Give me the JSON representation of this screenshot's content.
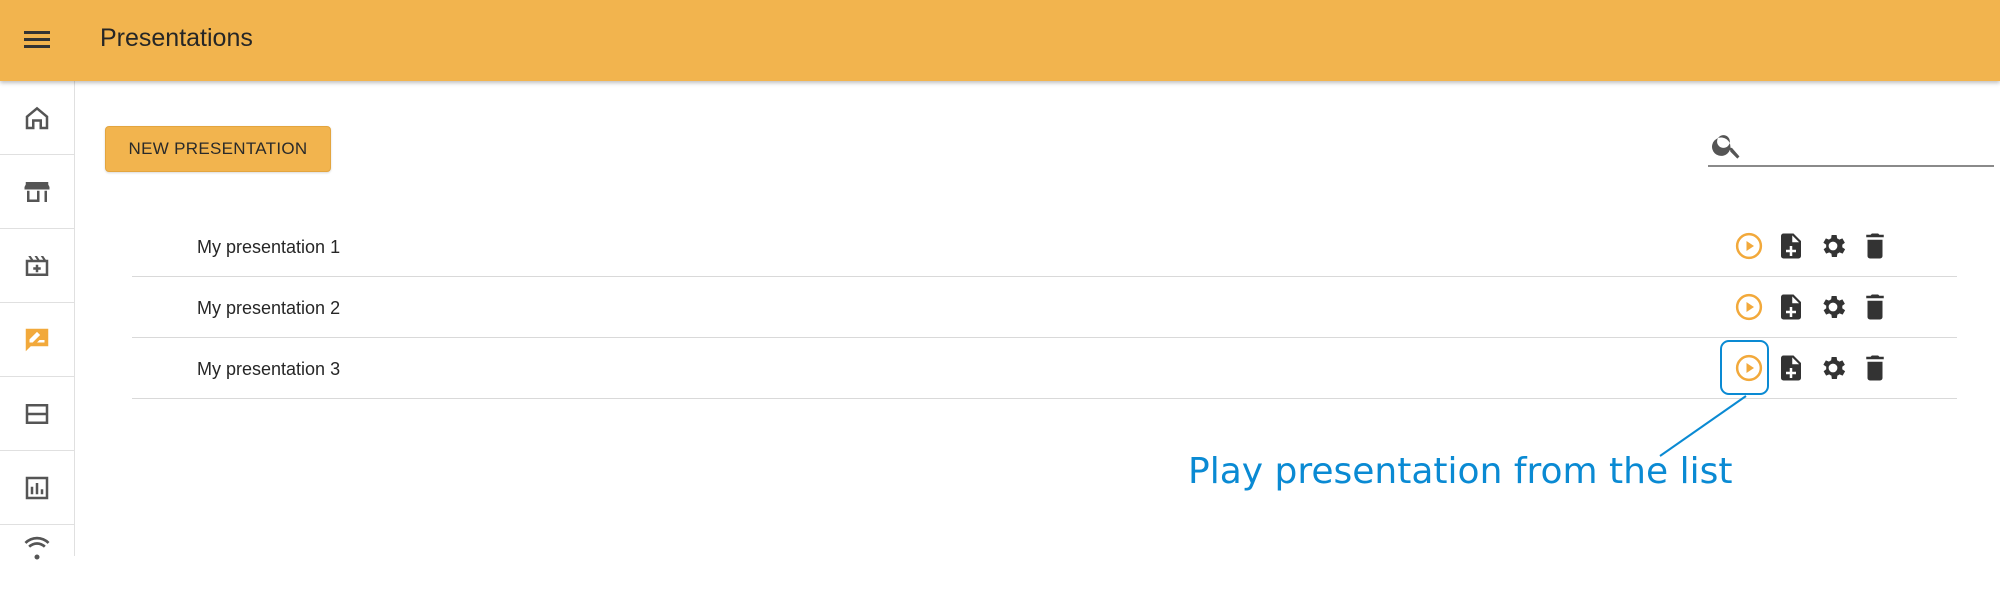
{
  "app": {
    "title": "Presentations"
  },
  "toolbar": {
    "new_label": "NEW PRESENTATION"
  },
  "search": {
    "placeholder": "",
    "value": ""
  },
  "sidebar": {
    "items": [
      {
        "icon": "home-icon"
      },
      {
        "icon": "store-icon"
      },
      {
        "icon": "movie-add-icon"
      },
      {
        "icon": "presentation-edit-icon",
        "active": true
      },
      {
        "icon": "table-layout-icon"
      },
      {
        "icon": "chart-icon"
      },
      {
        "icon": "wifi-icon"
      }
    ]
  },
  "presentations": [
    {
      "name": "My presentation 1"
    },
    {
      "name": "My presentation 2"
    },
    {
      "name": "My presentation 3"
    }
  ],
  "row_actions": [
    "play-icon",
    "add-file-icon",
    "settings-icon",
    "delete-icon"
  ],
  "annotation": {
    "text": "Play presentation from the list"
  },
  "colors": {
    "accent": "#f2b44e",
    "icon_dark": "#333333",
    "play": "#f2a93b",
    "callout": "#0a8ad3"
  }
}
